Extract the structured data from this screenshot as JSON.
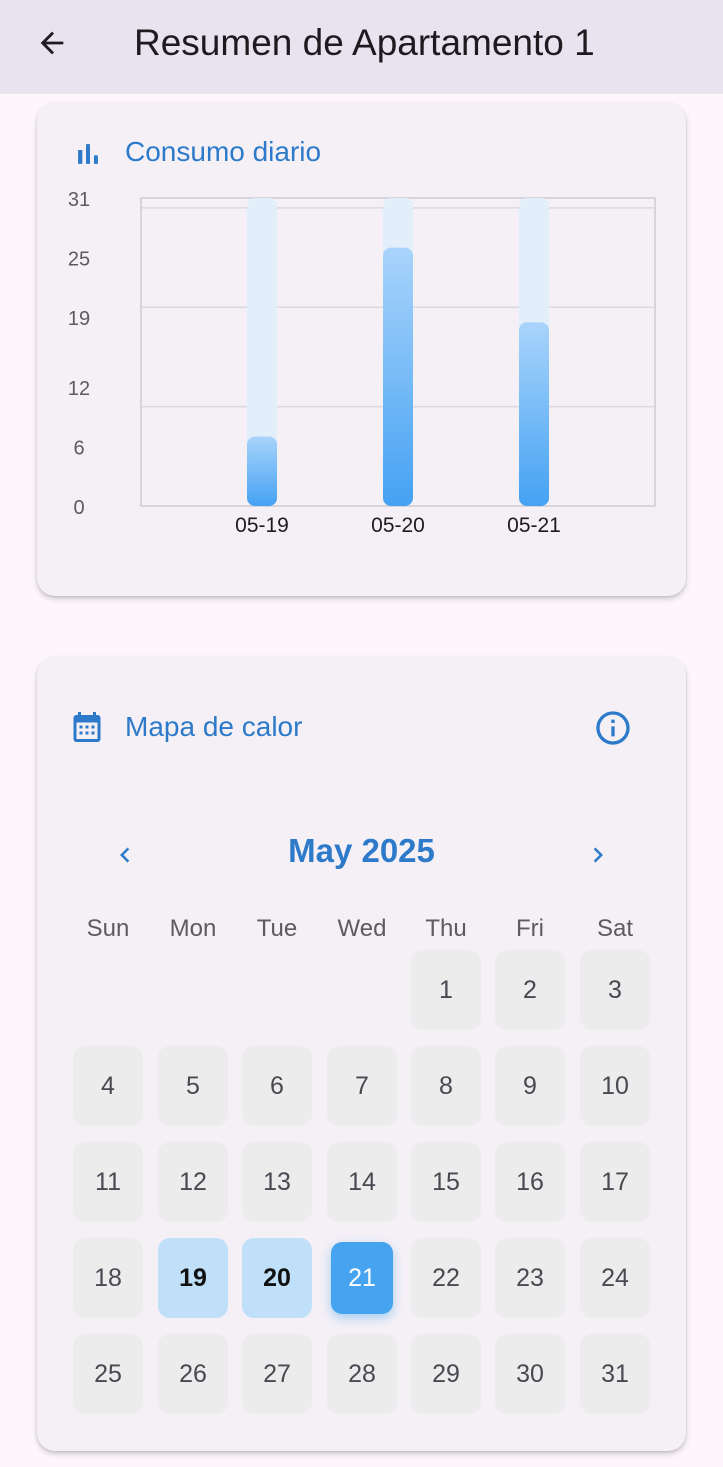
{
  "appbar": {
    "title": "Resumen de Apartamento 1",
    "back_icon": "arrow-left-icon"
  },
  "daily_card": {
    "title": "Consumo diario",
    "icon": "bar-chart-icon",
    "accent_color": "#2c7ac9"
  },
  "chart_data": {
    "type": "bar",
    "title": "Consumo diario",
    "categories": [
      "05-19",
      "05-20",
      "05-21"
    ],
    "values": [
      7,
      26,
      18.5
    ],
    "ylim": [
      0,
      31
    ],
    "yticks": [
      "0",
      "6",
      "12",
      "19",
      "25",
      "31"
    ],
    "xlabel": "",
    "ylabel": "",
    "grid": true,
    "bar_color": "#4aa8f2",
    "bar_bg_color": "#e3eefb"
  },
  "heatmap_card": {
    "title": "Mapa de calor",
    "icon": "calendar-icon",
    "info_icon": "info-icon",
    "prev_icon": "chevron-left-icon",
    "next_icon": "chevron-right-icon",
    "month_label": "May 2025",
    "weekdays": [
      "Sun",
      "Mon",
      "Tue",
      "Wed",
      "Thu",
      "Fri",
      "Sat"
    ],
    "first_weekday": 4,
    "days_in_month": 31,
    "highlighted_days": [
      19,
      20
    ],
    "selected_day": 21,
    "day_colors": {
      "default": "#ececec",
      "consumption": "#bfe0f8",
      "selected": "#45a3ef"
    }
  }
}
